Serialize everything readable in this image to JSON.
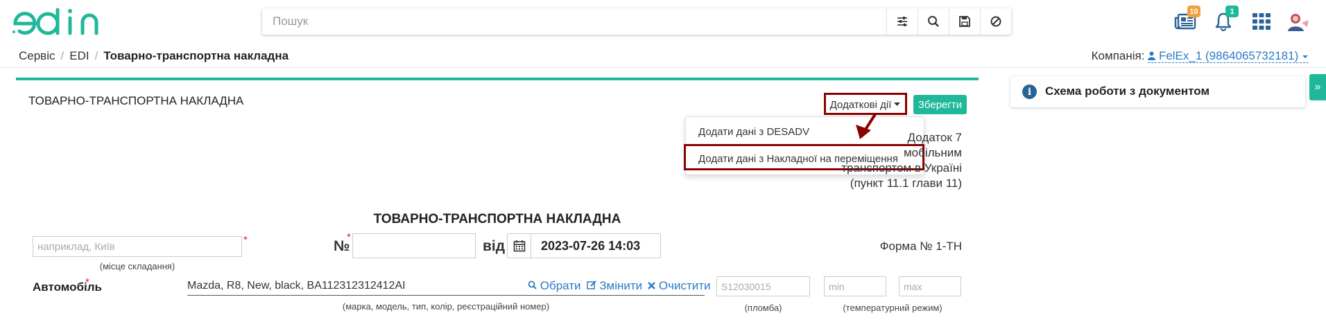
{
  "search": {
    "placeholder": "Пошук"
  },
  "badges": {
    "documents": "10",
    "notifications": "1"
  },
  "breadcrumb": {
    "items": [
      "Сервіс",
      "EDI"
    ],
    "current": "Товарно-транспортна накладна"
  },
  "company": {
    "label": "Компанія:",
    "value": "FelEx_1 (9864065732181)"
  },
  "document": {
    "title": "ТОВАРНО-ТРАНСПОРТНА НАКЛАДНА",
    "actions_label": "Додаткові дії",
    "save_label": "Зберегти",
    "dropdown": [
      "Додати дані з DESADV",
      "Додати дані з Накладної на переміщення"
    ],
    "appendix": [
      "Додаток 7",
      "мобільним",
      "транспортом в Україні",
      "(пункт 11.1 глави 11)"
    ],
    "form_title": "ТОВАРНО-ТРАНСПОРТНА НАКЛАДНА",
    "place_placeholder": "наприклад, Київ",
    "place_hint": "(місце складання)",
    "number_label": "№",
    "from_label": "від",
    "date_value": "2023-07-26 14:03",
    "form_number": "Форма № 1-ТН",
    "car_label": "Автомобіль",
    "car_value": "Mazda, R8, New, black, BA112312312412AI",
    "car_hint": "(марка, модель, тип, колір, реєстраційний номер)",
    "link_choose": "Обрати",
    "link_change": "Змінити",
    "link_clear": "Очистити",
    "seal_placeholder": "S12030015",
    "seal_hint": "(пломба)",
    "min_placeholder": "min",
    "max_placeholder": "max",
    "temp_hint": "(температурний режим)"
  },
  "side": {
    "title": "Схема роботи з документом"
  },
  "colors": {
    "accent": "#1fb89a",
    "highlight": "#8b0000",
    "link": "#2a7bc6"
  }
}
